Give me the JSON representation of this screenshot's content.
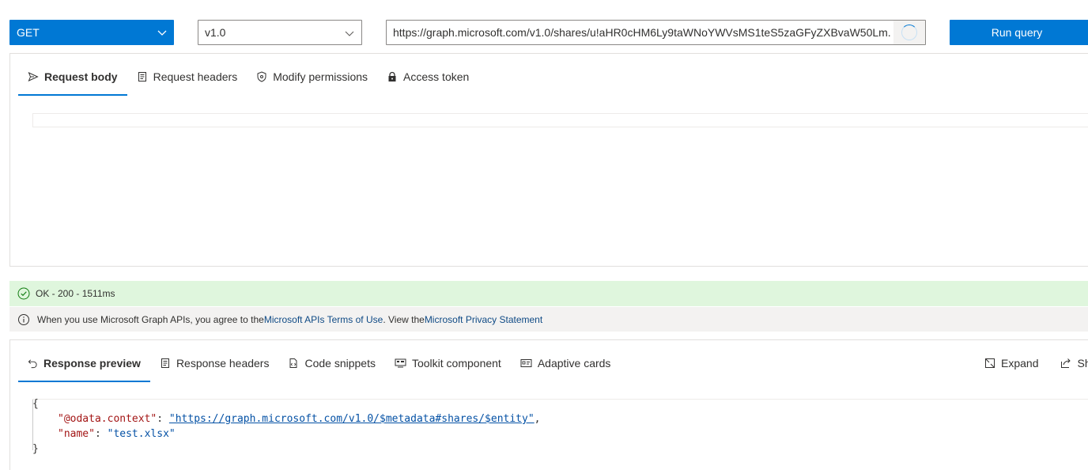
{
  "toolbar": {
    "method": "GET",
    "version": "v1.0",
    "url": "https://graph.microsoft.com/v1.0/shares/u!aHR0cHM6Ly9taWNoYWVsMS1teS5zaGFyZXBvaW50Lm...",
    "run_label": "Run query"
  },
  "request": {
    "tabs": [
      {
        "label": "Request body",
        "icon": "send-icon"
      },
      {
        "label": "Request headers",
        "icon": "document-icon"
      },
      {
        "label": "Modify permissions",
        "icon": "shield-icon"
      },
      {
        "label": "Access token",
        "icon": "lock-icon"
      }
    ]
  },
  "status": {
    "ok_text": "OK - 200 - 1511ms",
    "info_prefix": "When you use Microsoft Graph APIs, you agree to the ",
    "terms_link": "Microsoft APIs Terms of Use",
    "info_middle": ". View the ",
    "privacy_link": "Microsoft Privacy Statement"
  },
  "response": {
    "tabs": [
      {
        "label": "Response preview",
        "icon": "undo-icon"
      },
      {
        "label": "Response headers",
        "icon": "document-icon"
      },
      {
        "label": "Code snippets",
        "icon": "code-icon"
      },
      {
        "label": "Toolkit component",
        "icon": "toolkit-icon"
      },
      {
        "label": "Adaptive cards",
        "icon": "card-icon"
      }
    ],
    "actions": [
      {
        "label": "Expand",
        "icon": "expand-icon"
      },
      {
        "label": "Share",
        "icon": "share-icon"
      }
    ],
    "json": {
      "open_brace": "{",
      "close_brace": "}",
      "lines": [
        {
          "key": "\"@odata.context\"",
          "value": "\"https://graph.microsoft.com/v1.0/$metadata#shares/$entity\"",
          "is_link": true,
          "trail": ","
        },
        {
          "key": "\"name\"",
          "value": "\"test.xlsx\"",
          "is_link": false,
          "trail": ""
        }
      ]
    }
  },
  "colors": {
    "accent": "#0078d4",
    "ok_bg": "#dff6dd",
    "info_bg": "#f3f2f1",
    "json_key": "#a31515",
    "json_value": "#0451a5"
  }
}
